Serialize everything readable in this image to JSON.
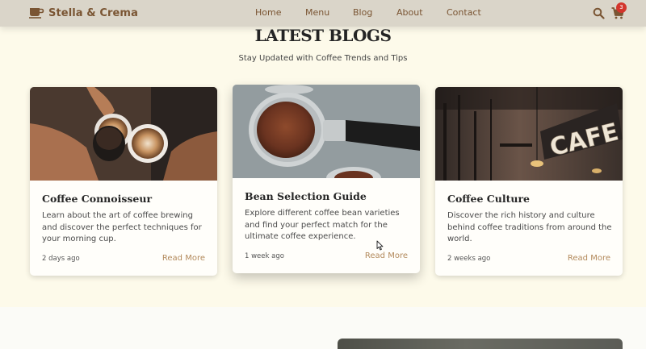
{
  "brand": {
    "name": "Stella & Crema",
    "icon": "coffee-cup-icon"
  },
  "nav": {
    "links": [
      "Home",
      "Menu",
      "Blog",
      "About",
      "Contact"
    ]
  },
  "cart": {
    "count": "3"
  },
  "section": {
    "title": "LATEST BLOGS",
    "subtitle": "Stay Updated with Coffee Trends and Tips"
  },
  "cards": [
    {
      "title": "Coffee Connoisseur",
      "description": "Learn about the art of coffee brewing and discover the perfect techniques for your morning cup.",
      "date": "2 days ago",
      "link": "Read More",
      "image": "latte-art-cups-image"
    },
    {
      "title": "Bean Selection Guide",
      "description": "Explore different coffee bean varieties and find your perfect match for the ultimate coffee experience.",
      "date": "1 week ago",
      "link": "Read More",
      "image": "portafilter-grounds-image"
    },
    {
      "title": "Coffee Culture",
      "description": "Discover the rich history and culture behind coffee traditions from around the world.",
      "date": "2 weeks ago",
      "link": "Read More",
      "image": "cafe-sign-image"
    }
  ],
  "colors": {
    "nav_bg": "#dad5c9",
    "brand_brown": "#7a5533",
    "page_bg": "#fdfaea",
    "link_accent": "#b38a5c",
    "badge_red": "#d3352c"
  }
}
